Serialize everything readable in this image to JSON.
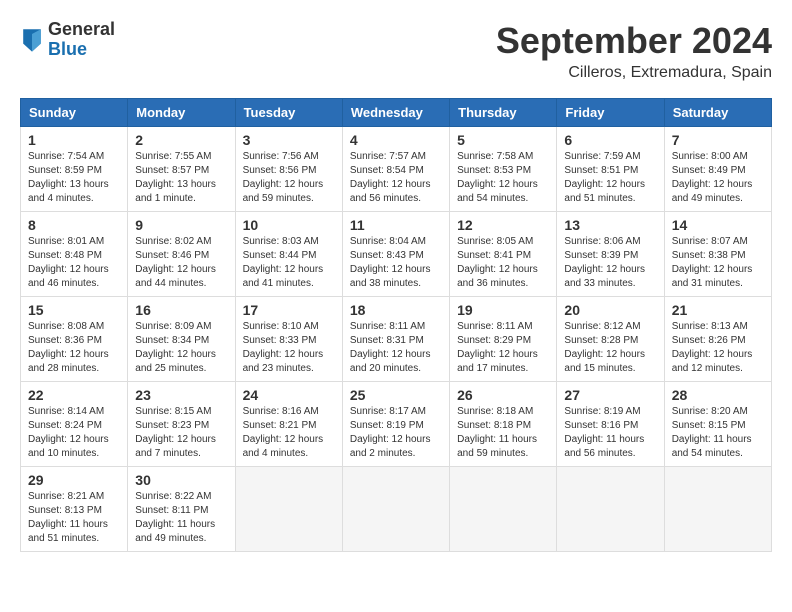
{
  "logo": {
    "line1": "General",
    "line2": "Blue"
  },
  "title": "September 2024",
  "location": "Cilleros, Extremadura, Spain",
  "headers": [
    "Sunday",
    "Monday",
    "Tuesday",
    "Wednesday",
    "Thursday",
    "Friday",
    "Saturday"
  ],
  "weeks": [
    [
      {
        "day": "1",
        "sunrise": "Sunrise: 7:54 AM",
        "sunset": "Sunset: 8:59 PM",
        "daylight": "Daylight: 13 hours and 4 minutes."
      },
      {
        "day": "2",
        "sunrise": "Sunrise: 7:55 AM",
        "sunset": "Sunset: 8:57 PM",
        "daylight": "Daylight: 13 hours and 1 minute."
      },
      {
        "day": "3",
        "sunrise": "Sunrise: 7:56 AM",
        "sunset": "Sunset: 8:56 PM",
        "daylight": "Daylight: 12 hours and 59 minutes."
      },
      {
        "day": "4",
        "sunrise": "Sunrise: 7:57 AM",
        "sunset": "Sunset: 8:54 PM",
        "daylight": "Daylight: 12 hours and 56 minutes."
      },
      {
        "day": "5",
        "sunrise": "Sunrise: 7:58 AM",
        "sunset": "Sunset: 8:53 PM",
        "daylight": "Daylight: 12 hours and 54 minutes."
      },
      {
        "day": "6",
        "sunrise": "Sunrise: 7:59 AM",
        "sunset": "Sunset: 8:51 PM",
        "daylight": "Daylight: 12 hours and 51 minutes."
      },
      {
        "day": "7",
        "sunrise": "Sunrise: 8:00 AM",
        "sunset": "Sunset: 8:49 PM",
        "daylight": "Daylight: 12 hours and 49 minutes."
      }
    ],
    [
      {
        "day": "8",
        "sunrise": "Sunrise: 8:01 AM",
        "sunset": "Sunset: 8:48 PM",
        "daylight": "Daylight: 12 hours and 46 minutes."
      },
      {
        "day": "9",
        "sunrise": "Sunrise: 8:02 AM",
        "sunset": "Sunset: 8:46 PM",
        "daylight": "Daylight: 12 hours and 44 minutes."
      },
      {
        "day": "10",
        "sunrise": "Sunrise: 8:03 AM",
        "sunset": "Sunset: 8:44 PM",
        "daylight": "Daylight: 12 hours and 41 minutes."
      },
      {
        "day": "11",
        "sunrise": "Sunrise: 8:04 AM",
        "sunset": "Sunset: 8:43 PM",
        "daylight": "Daylight: 12 hours and 38 minutes."
      },
      {
        "day": "12",
        "sunrise": "Sunrise: 8:05 AM",
        "sunset": "Sunset: 8:41 PM",
        "daylight": "Daylight: 12 hours and 36 minutes."
      },
      {
        "day": "13",
        "sunrise": "Sunrise: 8:06 AM",
        "sunset": "Sunset: 8:39 PM",
        "daylight": "Daylight: 12 hours and 33 minutes."
      },
      {
        "day": "14",
        "sunrise": "Sunrise: 8:07 AM",
        "sunset": "Sunset: 8:38 PM",
        "daylight": "Daylight: 12 hours and 31 minutes."
      }
    ],
    [
      {
        "day": "15",
        "sunrise": "Sunrise: 8:08 AM",
        "sunset": "Sunset: 8:36 PM",
        "daylight": "Daylight: 12 hours and 28 minutes."
      },
      {
        "day": "16",
        "sunrise": "Sunrise: 8:09 AM",
        "sunset": "Sunset: 8:34 PM",
        "daylight": "Daylight: 12 hours and 25 minutes."
      },
      {
        "day": "17",
        "sunrise": "Sunrise: 8:10 AM",
        "sunset": "Sunset: 8:33 PM",
        "daylight": "Daylight: 12 hours and 23 minutes."
      },
      {
        "day": "18",
        "sunrise": "Sunrise: 8:11 AM",
        "sunset": "Sunset: 8:31 PM",
        "daylight": "Daylight: 12 hours and 20 minutes."
      },
      {
        "day": "19",
        "sunrise": "Sunrise: 8:11 AM",
        "sunset": "Sunset: 8:29 PM",
        "daylight": "Daylight: 12 hours and 17 minutes."
      },
      {
        "day": "20",
        "sunrise": "Sunrise: 8:12 AM",
        "sunset": "Sunset: 8:28 PM",
        "daylight": "Daylight: 12 hours and 15 minutes."
      },
      {
        "day": "21",
        "sunrise": "Sunrise: 8:13 AM",
        "sunset": "Sunset: 8:26 PM",
        "daylight": "Daylight: 12 hours and 12 minutes."
      }
    ],
    [
      {
        "day": "22",
        "sunrise": "Sunrise: 8:14 AM",
        "sunset": "Sunset: 8:24 PM",
        "daylight": "Daylight: 12 hours and 10 minutes."
      },
      {
        "day": "23",
        "sunrise": "Sunrise: 8:15 AM",
        "sunset": "Sunset: 8:23 PM",
        "daylight": "Daylight: 12 hours and 7 minutes."
      },
      {
        "day": "24",
        "sunrise": "Sunrise: 8:16 AM",
        "sunset": "Sunset: 8:21 PM",
        "daylight": "Daylight: 12 hours and 4 minutes."
      },
      {
        "day": "25",
        "sunrise": "Sunrise: 8:17 AM",
        "sunset": "Sunset: 8:19 PM",
        "daylight": "Daylight: 12 hours and 2 minutes."
      },
      {
        "day": "26",
        "sunrise": "Sunrise: 8:18 AM",
        "sunset": "Sunset: 8:18 PM",
        "daylight": "Daylight: 11 hours and 59 minutes."
      },
      {
        "day": "27",
        "sunrise": "Sunrise: 8:19 AM",
        "sunset": "Sunset: 8:16 PM",
        "daylight": "Daylight: 11 hours and 56 minutes."
      },
      {
        "day": "28",
        "sunrise": "Sunrise: 8:20 AM",
        "sunset": "Sunset: 8:15 PM",
        "daylight": "Daylight: 11 hours and 54 minutes."
      }
    ],
    [
      {
        "day": "29",
        "sunrise": "Sunrise: 8:21 AM",
        "sunset": "Sunset: 8:13 PM",
        "daylight": "Daylight: 11 hours and 51 minutes."
      },
      {
        "day": "30",
        "sunrise": "Sunrise: 8:22 AM",
        "sunset": "Sunset: 8:11 PM",
        "daylight": "Daylight: 11 hours and 49 minutes."
      },
      null,
      null,
      null,
      null,
      null
    ]
  ]
}
